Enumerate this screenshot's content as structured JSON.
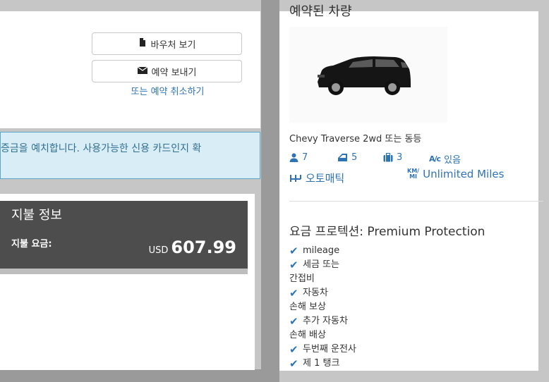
{
  "actions": {
    "view_voucher": "바우처 보기",
    "send_reservation": "예약 보내기",
    "cancel_link": "또는 예약 취소하기"
  },
  "notice": {
    "text": "증금을 예치합니다. 사용가능한 신용 카드인지 확"
  },
  "payment": {
    "title": "지불 정보",
    "label": "지불 요금:",
    "currency": "USD",
    "amount": "607.99"
  },
  "vehicle": {
    "section_title": "예약된 차량",
    "name": "Chevy Traverse 2wd 또는 동등",
    "seats": "7",
    "doors": "5",
    "bags": "3",
    "ac_symbol": "A/c",
    "ac_label": "있음",
    "transmission": "오토매틱",
    "mileage_symbol_top": "KM/",
    "mileage_symbol_bottom": "MI",
    "mileage": "Unlimited Miles"
  },
  "protection": {
    "title": "요금 프로텍션: Premium Protection",
    "items": [
      {
        "check": true,
        "text": "mileage"
      },
      {
        "check": true,
        "text": "세금 또는"
      },
      {
        "check": false,
        "text": "간접비"
      },
      {
        "check": true,
        "text": "자동차"
      },
      {
        "check": false,
        "text": "손해 보상"
      },
      {
        "check": true,
        "text": "추가 자동차"
      },
      {
        "check": false,
        "text": "손해 배상"
      },
      {
        "check": true,
        "text": "두번째 운전사"
      },
      {
        "check": true,
        "text": "제 1 탱크"
      }
    ]
  },
  "colors": {
    "accent": "#2e74b5",
    "payment_bg": "#4d4d4d",
    "notice_bg": "#d9edf7"
  }
}
